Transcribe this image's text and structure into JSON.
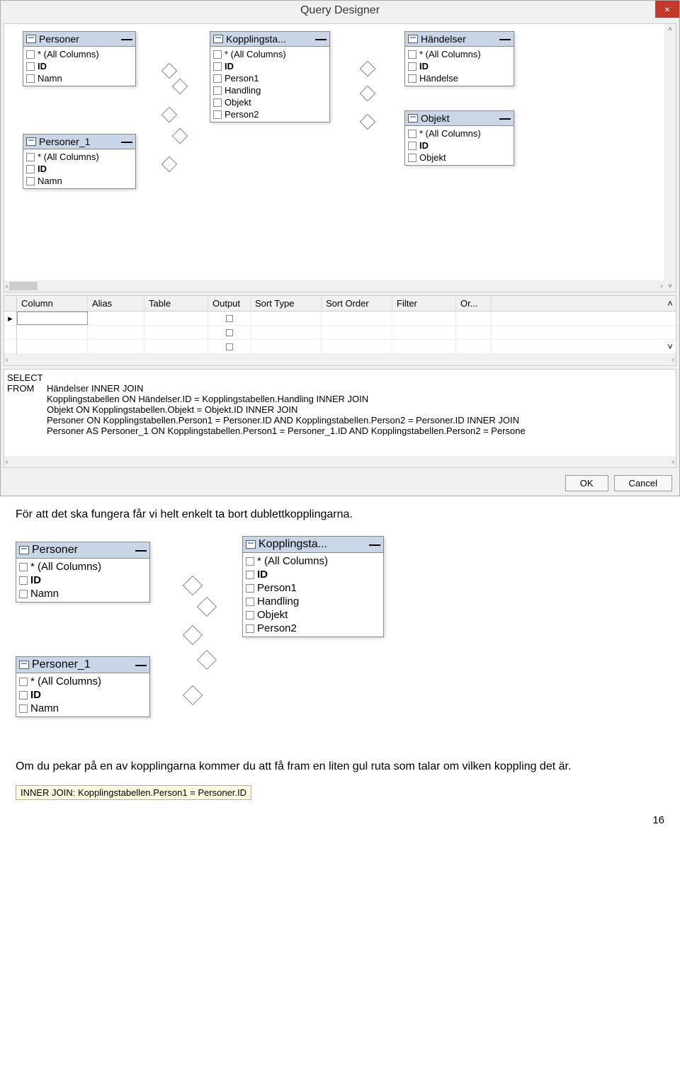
{
  "window": {
    "title": "Query Designer",
    "close": "×"
  },
  "tables": {
    "personer": {
      "title": "Personer",
      "cols": [
        "* (All Columns)",
        "ID",
        "Namn"
      ]
    },
    "personer1": {
      "title": "Personer_1",
      "cols": [
        "* (All Columns)",
        "ID",
        "Namn"
      ]
    },
    "kopplingsta": {
      "title": "Kopplingsta...",
      "cols": [
        "* (All Columns)",
        "ID",
        "Person1",
        "Handling",
        "Objekt",
        "Person2"
      ]
    },
    "handelser": {
      "title": "Händelser",
      "cols": [
        "* (All Columns)",
        "ID",
        "Händelse"
      ]
    },
    "objekt": {
      "title": "Objekt",
      "cols": [
        "* (All Columns)",
        "ID",
        "Objekt"
      ]
    }
  },
  "grid": {
    "headers": [
      "Column",
      "Alias",
      "Table",
      "Output",
      "Sort Type",
      "Sort Order",
      "Filter",
      "Or..."
    ]
  },
  "sql": {
    "select": "SELECT",
    "from": "FROM",
    "line1": "Händelser INNER JOIN",
    "line2": "Kopplingstabellen ON Händelser.ID = Kopplingstabellen.Handling INNER JOIN",
    "line3": "Objekt ON Kopplingstabellen.Objekt = Objekt.ID INNER JOIN",
    "line4": "Personer ON Kopplingstabellen.Person1 = Personer.ID AND Kopplingstabellen.Person2 = Personer.ID INNER JOIN",
    "line5": "Personer AS Personer_1 ON Kopplingstabellen.Person1 = Personer_1.ID AND Kopplingstabellen.Person2 = Persone"
  },
  "buttons": {
    "ok": "OK",
    "cancel": "Cancel"
  },
  "text": {
    "p1": "För att det ska fungera får vi helt enkelt ta bort dublettkopplingarna.",
    "p2": "Om du pekar på en av kopplingarna kommer du att få fram en liten gul ruta som talar om vilken koppling det är."
  },
  "tooltip": "INNER JOIN: Kopplingstabellen.Person1 = Personer.ID",
  "pageNumber": "16",
  "scroll": {
    "left": "‹",
    "right": "›",
    "up": "˄",
    "down": "˅"
  }
}
